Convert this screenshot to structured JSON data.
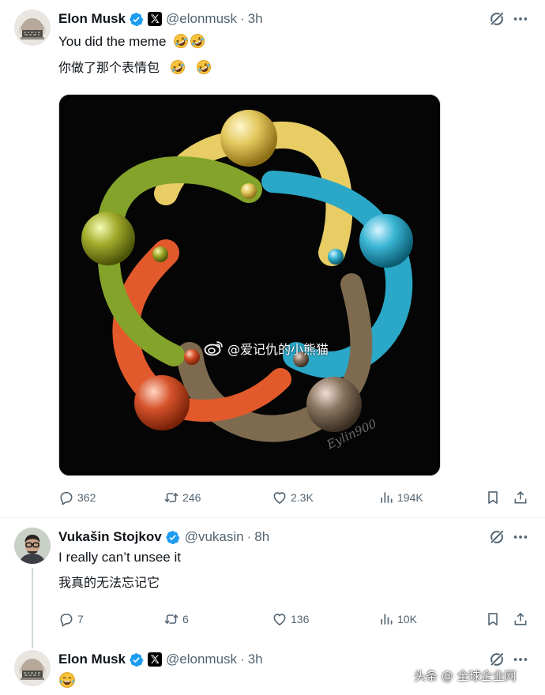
{
  "tweets": [
    {
      "author": "Elon Musk",
      "handle": "@elonmusk",
      "time": "3h",
      "text_en": "You did the meme",
      "text_cn": "你做了那个表情包",
      "stats": {
        "replies": "362",
        "reposts": "246",
        "likes": "2.3K",
        "views": "194K"
      }
    },
    {
      "author": "Vukašin Stojkov",
      "handle": "@vukasin",
      "time": "8h",
      "text_en": "I really can’t unsee it",
      "text_cn": "我真的无法忘记它",
      "stats": {
        "replies": "7",
        "reposts": "6",
        "likes": "136",
        "views": "10K"
      }
    },
    {
      "author": "Elon Musk",
      "handle": "@elonmusk",
      "time": "3h"
    }
  ],
  "image": {
    "weibo_watermark": "@爱记仇的小熊猫",
    "artist_signature": "Eylin900"
  },
  "footer_watermark": "头条 @ 全球企业网",
  "icons": {
    "verified": "verified-badge-icon",
    "x_affiliate": "x-logo-icon",
    "grok": "grok-icon",
    "more": "more-icon",
    "reply": "reply-icon",
    "repost": "repost-icon",
    "like": "like-icon",
    "views": "views-icon",
    "bookmark": "bookmark-icon",
    "share": "share-icon",
    "emoji_laughing": "rolling-on-floor-laughing-emoji",
    "emoji_tears": "tears-of-joy-emoji"
  },
  "colors": {
    "verified": "#1d9bf0",
    "text_primary": "#0f1419",
    "text_secondary": "#536471",
    "yellow_arm": "#e7cd64",
    "cyan_arm": "#2ba7c7",
    "brown_arm": "#7e6b4f",
    "orange_arm": "#e25a2c",
    "green_arm": "#83a32a"
  }
}
